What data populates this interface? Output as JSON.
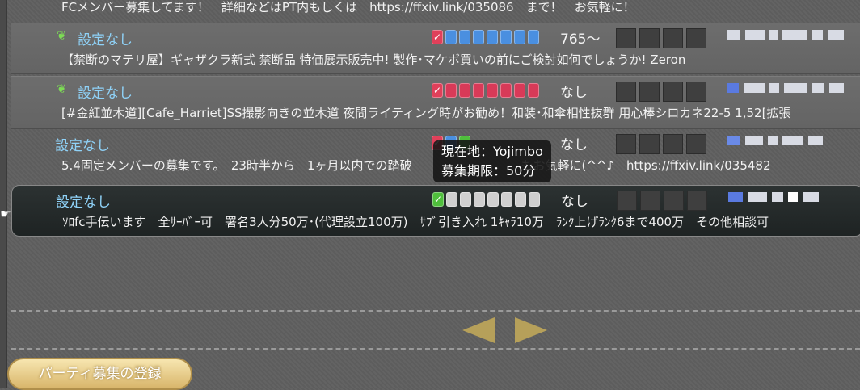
{
  "rows": [
    {
      "name": "",
      "comment": "FCメンバー募集してます！　詳細などはPT内もしくは　https://ffxiv.link/035086　まで！　お気軽に！",
      "ilvl": "",
      "slots": []
    },
    {
      "name": "設定なし",
      "sprout": true,
      "comment": "【禁断のマテリ屋】ギャザクラ新式 禁断品 特価展示販売中! 製作･マケボ買いの前にご検討如何でしょうか! Zeron",
      "ilvl": "765～",
      "slots": [
        "check",
        "blue",
        "blue",
        "blue",
        "blue",
        "blue",
        "blue",
        "blue"
      ]
    },
    {
      "name": "設定なし",
      "sprout": true,
      "comment": "[#金紅並木道][Cafe_Harriet]SS撮影向きの並木道 夜間ライティング時がお勧め！和装･和傘相性抜群 用心棒シロカネ22-5 1,52[拡張",
      "ilvl": "なし",
      "slots": [
        "check",
        "red",
        "red",
        "red",
        "red",
        "red",
        "red",
        "red"
      ]
    },
    {
      "name": "設定なし",
      "sprout": false,
      "comment": "5.4固定メンバーの募集です。　23時半から　1ヶ月以内での踏破　　　　　　　　　もお気軽に(^^♪　https://ffxiv.link/035482",
      "ilvl": "なし",
      "slots": [
        "check",
        "blue",
        "green"
      ]
    },
    {
      "name": "設定なし",
      "sprout": false,
      "comment": "ｿﾛfc手伝います　全ｻｰﾊﾞｰ可　署名3人分50万･(代理設立100万)　ｻﾌﾞ引き入れ 1ｷｬﾗ10万　ﾗﾝｸ上げﾗﾝｸ6まで400万　その他相談可",
      "ilvl": "なし",
      "slots": [
        "check-green",
        "gray",
        "gray",
        "gray",
        "gray",
        "gray",
        "gray",
        "gray"
      ]
    }
  ],
  "tooltip": {
    "location": "現在地：Yojimbo",
    "period": "募集期限：50分"
  },
  "register_button": "パーティ募集の登録",
  "colors": {
    "blue": "#4a8fe0",
    "red": "#d83a58",
    "green": "#4fbf3c",
    "gray": "#cfcfcf",
    "check": "#e0405a"
  },
  "icons": {
    "sprout": "sprout-icon",
    "prev": "prev-page-icon",
    "next": "next-page-icon",
    "cursor": "hand-cursor-icon"
  }
}
